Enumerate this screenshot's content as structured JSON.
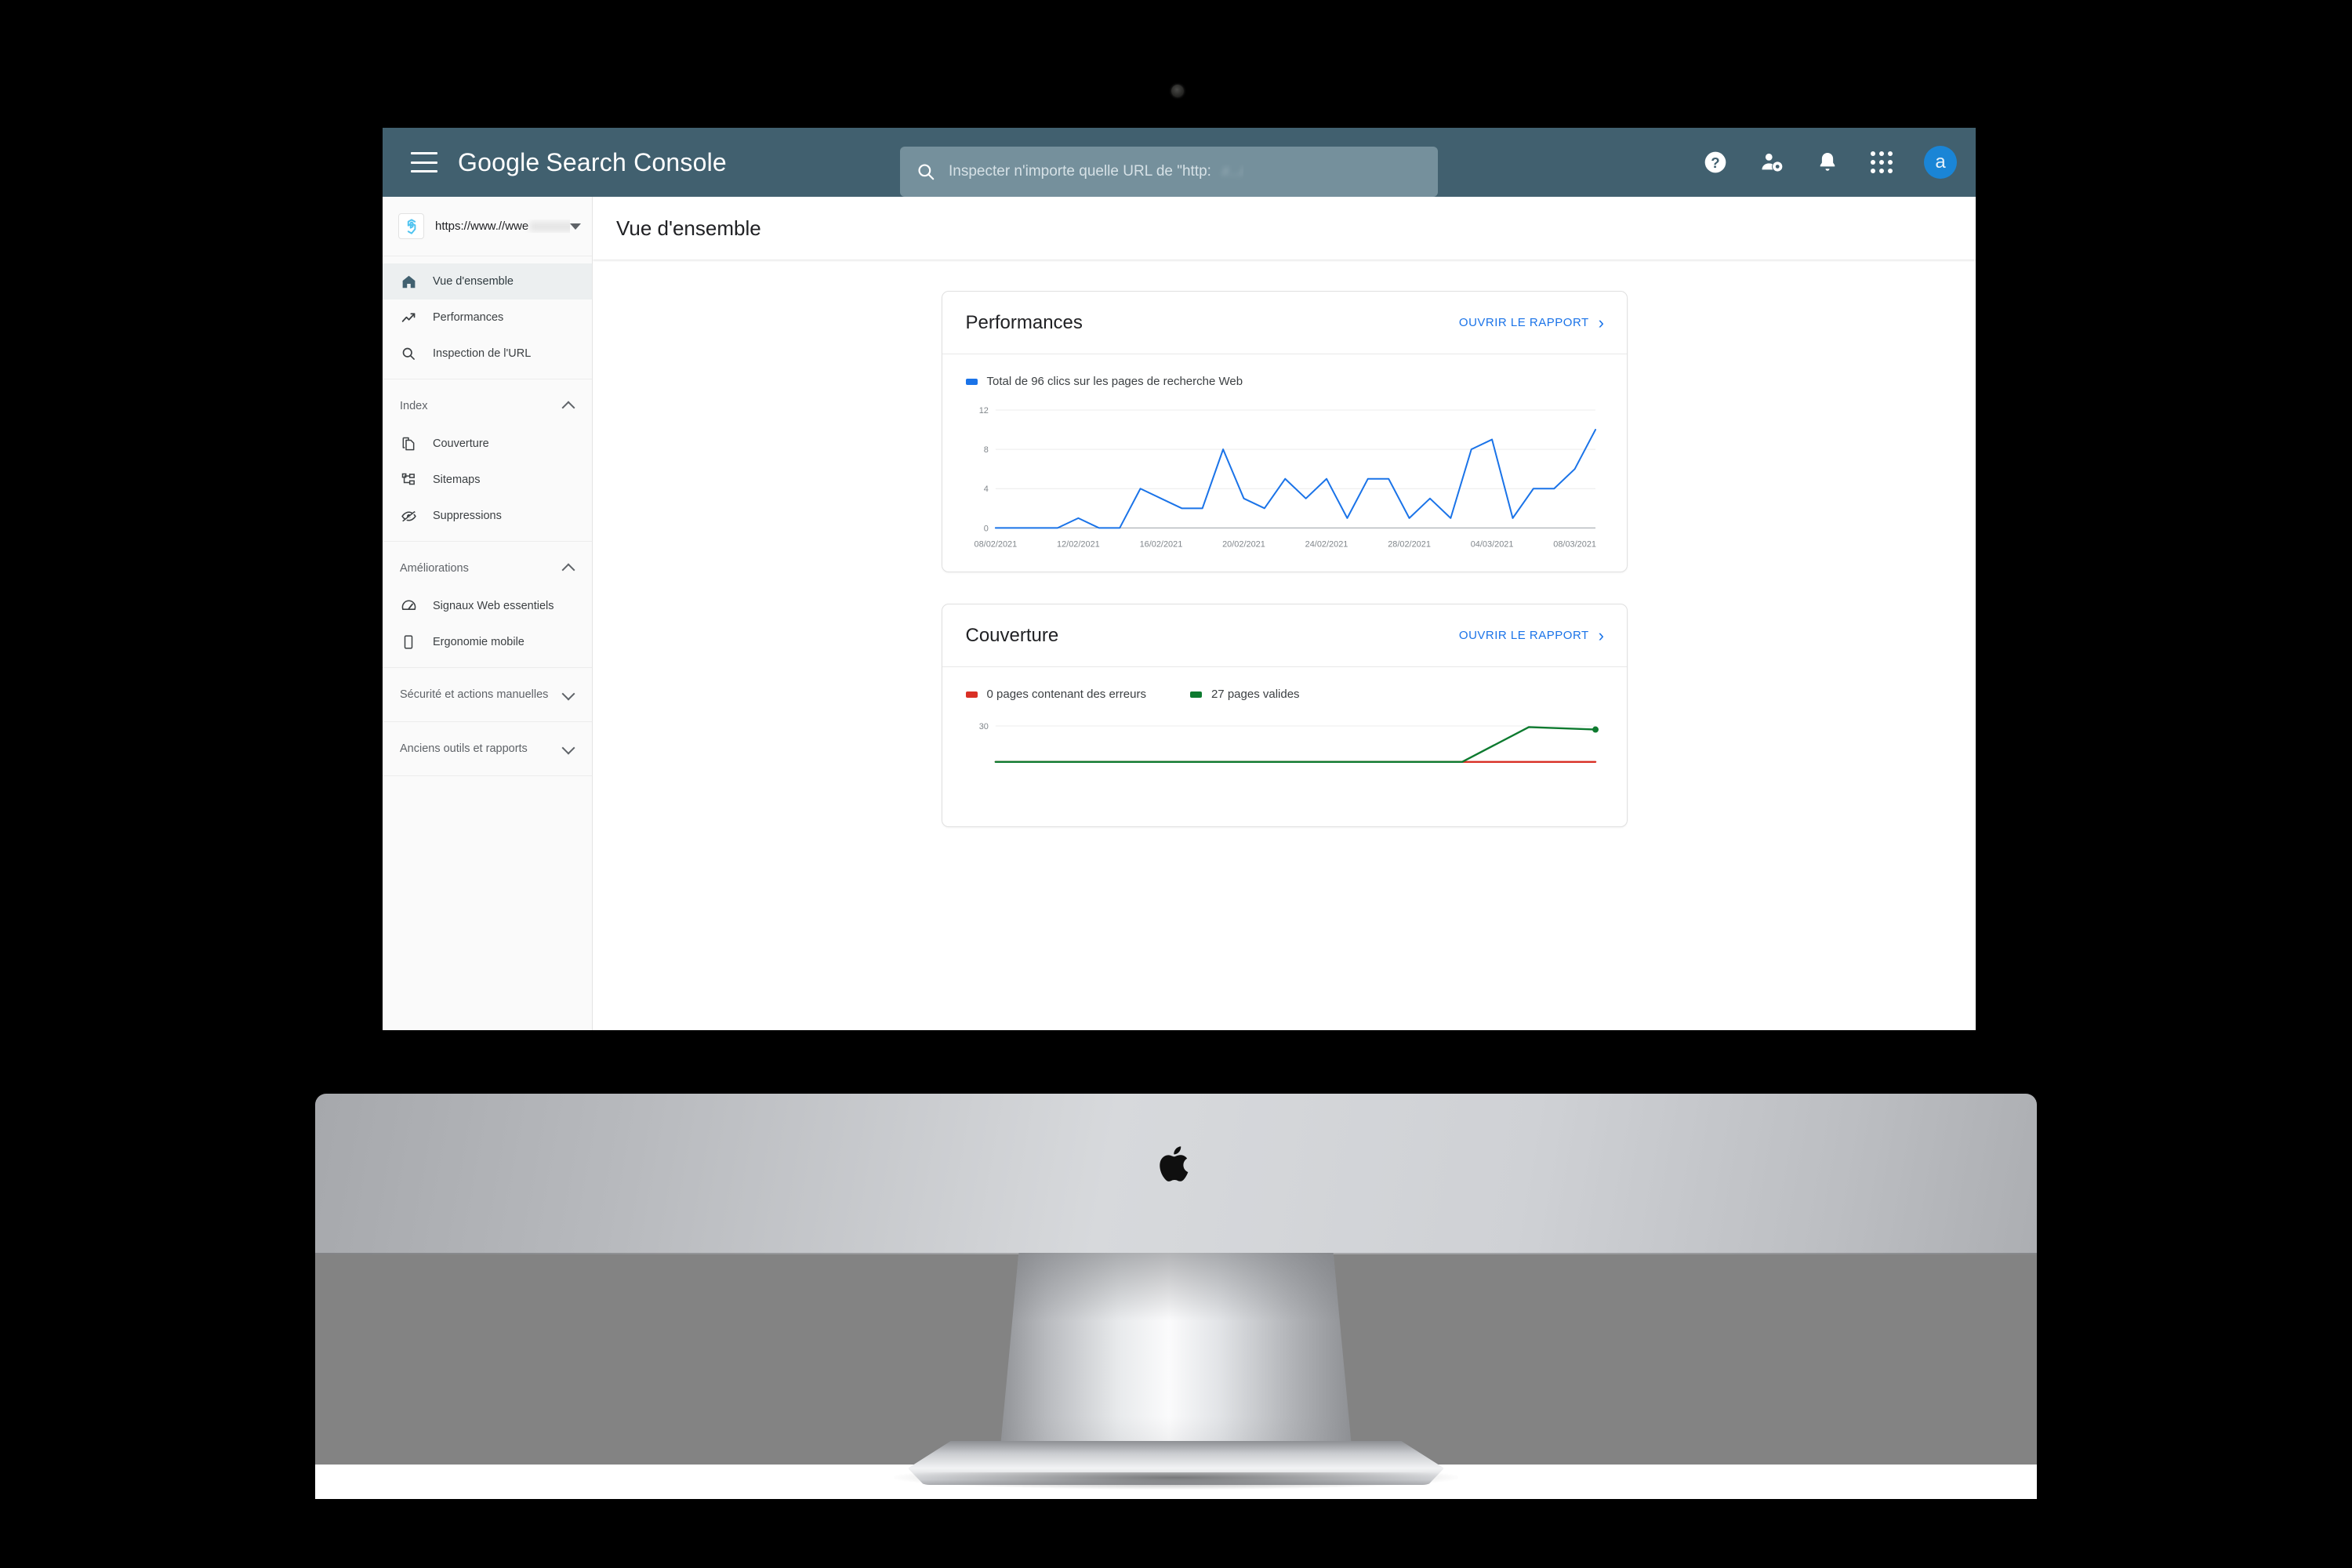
{
  "appbar": {
    "menu_icon": "hamburger-menu-icon",
    "brand_primary": "Google",
    "brand_secondary": "Search Console",
    "search": {
      "icon": "search-icon",
      "placeholder": "Inspecter n'importe quelle URL de \"http:",
      "redacted_suffix": "//…/"
    },
    "icons": [
      {
        "name": "help-icon",
        "label": "Aide"
      },
      {
        "name": "user-settings-icon",
        "label": "Paramètres du compte"
      },
      {
        "name": "notifications-bell-icon",
        "label": "Notifications"
      },
      {
        "name": "apps-grid-icon",
        "label": "Applications Google"
      }
    ],
    "avatar_initial": "a"
  },
  "sidebar": {
    "property": {
      "logo_icon": "property-logo-icon",
      "url": "https://www.//wwe"
    },
    "primary_items": [
      {
        "label": "Vue d'ensemble",
        "icon": "home-icon",
        "active": true
      },
      {
        "label": "Performances",
        "icon": "trending-up-icon",
        "active": false
      },
      {
        "label": "Inspection de l'URL",
        "icon": "search-icon",
        "active": false
      }
    ],
    "sections": [
      {
        "title": "Index",
        "expanded": true,
        "items": [
          {
            "label": "Couverture",
            "icon": "pages-copy-icon"
          },
          {
            "label": "Sitemaps",
            "icon": "sitemap-tree-icon"
          },
          {
            "label": "Suppressions",
            "icon": "eye-off-icon"
          }
        ]
      },
      {
        "title": "Améliorations",
        "expanded": true,
        "items": [
          {
            "label": "Signaux Web essentiels",
            "icon": "speed-gauge-icon"
          },
          {
            "label": "Ergonomie mobile",
            "icon": "mobile-phone-icon"
          }
        ]
      },
      {
        "title": "Sécurité et actions manuelles",
        "expanded": false,
        "items": []
      },
      {
        "title": "Anciens outils et rapports",
        "expanded": false,
        "items": []
      }
    ]
  },
  "page": {
    "title": "Vue d'ensemble"
  },
  "cards": {
    "performances": {
      "title": "Performances",
      "open_report_label": "OUVRIR LE RAPPORT",
      "legend_label": "Total de 96 clics sur les pages de recherche Web",
      "legend_color": "#1a73e8"
    },
    "couverture": {
      "title": "Couverture",
      "open_report_label": "OUVRIR LE RAPPORT",
      "legend": [
        {
          "label": "0 pages contenant des erreurs",
          "color": "#d93025"
        },
        {
          "label": "27 pages valides",
          "color": "#0d7a2f"
        }
      ]
    }
  },
  "chart_data": [
    {
      "id": "performances-chart",
      "type": "line",
      "title": "Total de 96 clics sur les pages de recherche Web",
      "xlabel": "",
      "ylabel": "",
      "ylim": [
        0,
        12
      ],
      "yticks": [
        0,
        4,
        8,
        12
      ],
      "grid": true,
      "legend_position": "top-left",
      "series_color": "#1a73e8",
      "x": [
        "08/02/2021",
        "09/02/2021",
        "10/02/2021",
        "11/02/2021",
        "12/02/2021",
        "13/02/2021",
        "14/02/2021",
        "15/02/2021",
        "16/02/2021",
        "17/02/2021",
        "18/02/2021",
        "19/02/2021",
        "20/02/2021",
        "21/02/2021",
        "22/02/2021",
        "23/02/2021",
        "24/02/2021",
        "25/02/2021",
        "26/02/2021",
        "27/02/2021",
        "28/02/2021",
        "01/03/2021",
        "02/03/2021",
        "03/03/2021",
        "04/03/2021",
        "05/03/2021",
        "06/03/2021",
        "07/03/2021",
        "08/03/2021",
        "09/03/2021"
      ],
      "tick_labels": [
        "08/02/2021",
        "12/02/2021",
        "16/02/2021",
        "20/02/2021",
        "24/02/2021",
        "28/02/2021",
        "04/03/2021",
        "08/03/2021"
      ],
      "values": [
        0,
        0,
        0,
        0,
        1,
        0,
        0,
        4,
        3,
        2,
        2,
        8,
        3,
        2,
        5,
        3,
        5,
        1,
        5,
        5,
        1,
        3,
        1,
        8,
        9,
        1,
        4,
        4,
        6,
        10
      ],
      "total_clicks": 96
    },
    {
      "id": "couverture-chart",
      "type": "line",
      "title": "Couverture",
      "ylim": [
        0,
        30
      ],
      "yticks": [
        30
      ],
      "grid": true,
      "series": [
        {
          "name": "0 pages contenant des erreurs",
          "color": "#d93025",
          "values": [
            0,
            0,
            0,
            0,
            0,
            0,
            0,
            0,
            0,
            0
          ]
        },
        {
          "name": "27 pages valides",
          "color": "#0d7a2f",
          "values": [
            0,
            0,
            0,
            0,
            0,
            0,
            0,
            0,
            29,
            27
          ]
        }
      ],
      "legend_position": "top-left",
      "note": "partially visible, clipped by viewport"
    }
  ],
  "device": {
    "brand_icon": "apple-logo-icon",
    "type": "imac-desktop"
  }
}
